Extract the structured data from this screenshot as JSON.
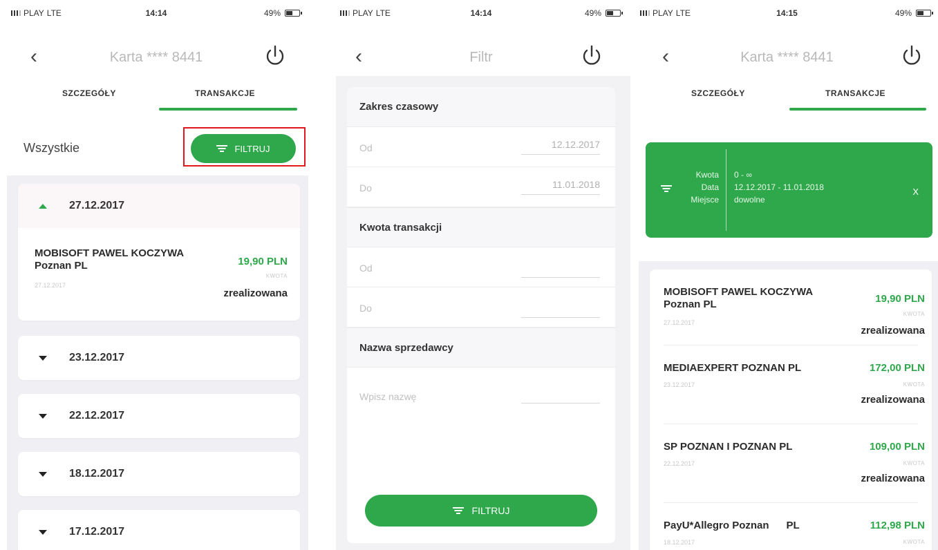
{
  "status_bar": {
    "carrier": "PLAY",
    "network": "LTE",
    "battery": "49%",
    "times": [
      "14:14",
      "14:14",
      "14:15"
    ]
  },
  "screen1": {
    "nav_title": "Karta **** 8441",
    "tabs": [
      "SZCZEGÓŁY",
      "TRANSAKCJE"
    ],
    "filter_label": "Wszystkie",
    "filter_button": "FILTRUJ",
    "expanded_group": {
      "date": "27.12.2017",
      "transaction": {
        "merchant_line1": "MOBISOFT PAWEL KOCZYWA",
        "merchant_line2": "Poznan PL",
        "date": "27.12.2017",
        "amount": "19,90 PLN",
        "amount_caption": "KWOTA",
        "status": "zrealizowana"
      }
    },
    "collapsed_groups": [
      "23.12.2017",
      "22.12.2017",
      "18.12.2017",
      "17.12.2017"
    ]
  },
  "screen2": {
    "nav_title": "Filtr",
    "sections": {
      "date_range": {
        "title": "Zakres czasowy",
        "from_label": "Od",
        "from_value": "12.12.2017",
        "to_label": "Do",
        "to_value": "11.01.2018"
      },
      "amount": {
        "title": "Kwota transakcji",
        "from_label": "Od",
        "to_label": "Do"
      },
      "merchant": {
        "title": "Nazwa sprzedawcy",
        "placeholder": "Wpisz nazwę"
      }
    },
    "filter_button": "FILTRUJ"
  },
  "screen3": {
    "nav_title": "Karta **** 8441",
    "tabs": [
      "SZCZEGÓŁY",
      "TRANSAKCJE"
    ],
    "summary": {
      "keys": [
        "Kwota",
        "Data",
        "Miejsce"
      ],
      "values": [
        "0 - ∞",
        "12.12.2017 - 11.01.2018",
        "dowolne"
      ],
      "close": "X"
    },
    "transactions": [
      {
        "merchant_line1": "MOBISOFT PAWEL KOCZYWA",
        "merchant_line2": "Poznan PL",
        "date": "27.12.2017",
        "amount": "19,90 PLN",
        "amount_caption": "KWOTA",
        "status": "zrealizowana"
      },
      {
        "merchant_line1": "MEDIAEXPERT POZNAN PL",
        "merchant_line2": "",
        "date": "23.12.2017",
        "amount": "172,00 PLN",
        "amount_caption": "KWOTA",
        "status": "zrealizowana"
      },
      {
        "merchant_line1": "SP POZNAN I POZNAN PL",
        "merchant_line2": "",
        "date": "22.12.2017",
        "amount": "109,00 PLN",
        "amount_caption": "KWOTA",
        "status": "zrealizowana"
      },
      {
        "merchant_line1": "PayU*Allegro Poznan      PL",
        "merchant_line2": "",
        "date": "18.12.2017",
        "amount": "112,98 PLN",
        "amount_caption": "KWOTA",
        "status": ""
      }
    ]
  },
  "colors": {
    "accent_green": "#2ea84a",
    "highlight_red": "#e0181b",
    "list_background": "#f0f0f4"
  },
  "icons": [
    "back-chevron-icon",
    "power-icon",
    "filter-icon",
    "caret-up-icon",
    "caret-down-icon",
    "signal-icon",
    "battery-icon"
  ]
}
